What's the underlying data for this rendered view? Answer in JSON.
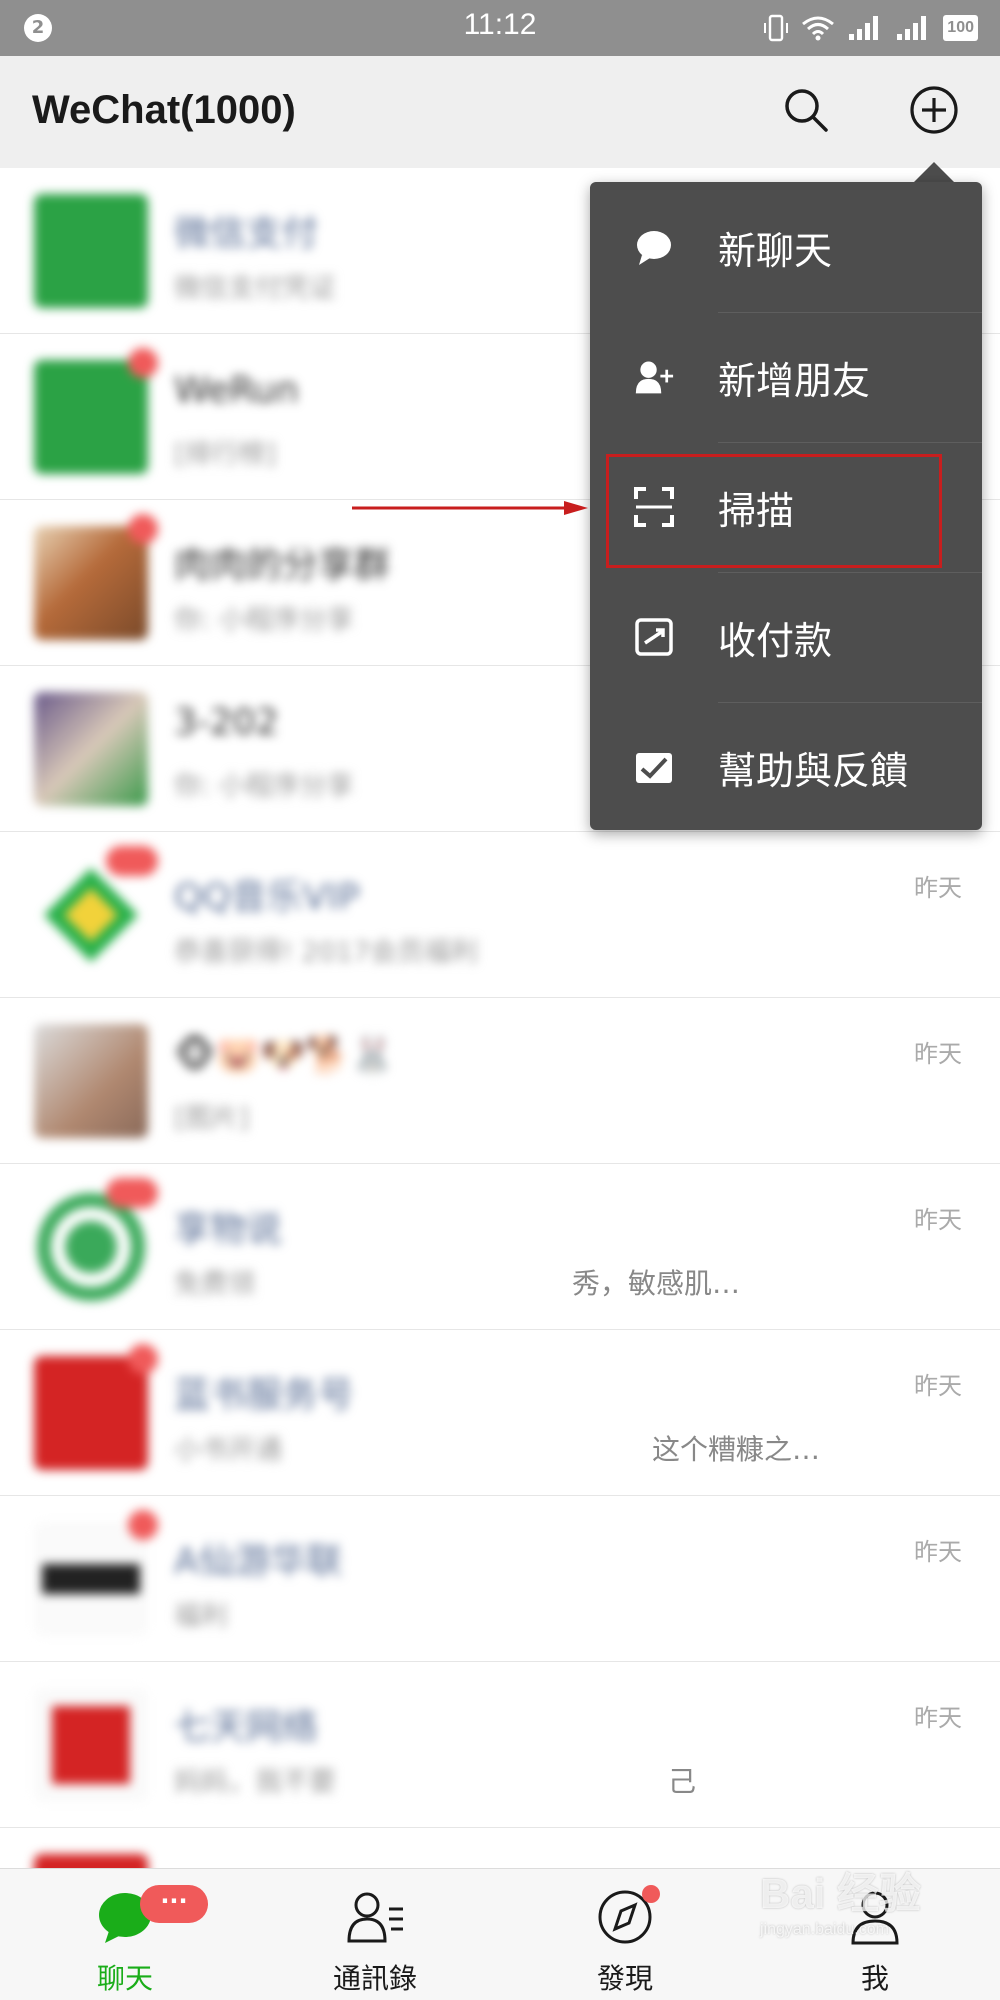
{
  "status_bar": {
    "notification_count": "2",
    "time": "11:12",
    "battery": "100",
    "icons": [
      "vibrate-icon",
      "wifi-icon",
      "signal-icon",
      "signal-icon"
    ]
  },
  "header": {
    "title": "WeChat(1000)",
    "search_icon": "search-icon",
    "add_icon": "plus-circle-icon"
  },
  "chats": [
    {
      "name": "微信支付",
      "preview": "微信支付凭证",
      "time": "",
      "badge": "",
      "avatar_color": "#2ba245"
    },
    {
      "name": "WeRun",
      "preview": "[排行榜]",
      "time": "",
      "badge": "",
      "avatar_color": "#2ba245"
    },
    {
      "name": "肉肉的分享群",
      "preview": "你: 小程序分享",
      "time": "",
      "badge": "",
      "avatar_color": "#b56a3a"
    },
    {
      "name": "3-202",
      "preview": "你: 小程序分享",
      "time": "",
      "badge": "",
      "avatar_color": "#6a5a8a"
    },
    {
      "name": "QQ音乐VIP",
      "preview": "恭喜获得! 2017会员福利",
      "time": "昨天",
      "badge": "",
      "avatar_color": "#27b04a"
    },
    {
      "name": "🐵🐷🐶🐕🐰",
      "preview": "[图片]",
      "time": "昨天",
      "badge": "",
      "avatar_color": "#b08870"
    },
    {
      "name": "享物说",
      "preview": "免费领 ",
      "preview_tail": "秀，敏感肌…",
      "time": "昨天",
      "badge": "",
      "avatar_color": "#3aa95a"
    },
    {
      "name": "蓝书服务号",
      "preview": "小书开通",
      "preview_tail": "这个糟糠之…",
      "time": "昨天",
      "badge": "",
      "avatar_color": "#d42424"
    },
    {
      "name": "A仙游华联",
      "preview": "福利",
      "time": "昨天",
      "badge": "",
      "avatar_color": "#222222"
    },
    {
      "name": "七天网络",
      "preview": "妈妈，我不要",
      "preview_tail": "己",
      "time": "昨天",
      "badge": "",
      "avatar_color": "#d42424"
    },
    {
      "name": "",
      "preview": "",
      "time": "",
      "badge": "",
      "avatar_color": "#d42424"
    }
  ],
  "menu": {
    "items": [
      {
        "label": "新聊天",
        "icon": "chat-bubble-icon"
      },
      {
        "label": "新增朋友",
        "icon": "add-friend-icon"
      },
      {
        "label": "掃描",
        "icon": "scan-icon"
      },
      {
        "label": "收付款",
        "icon": "payment-icon"
      },
      {
        "label": "幫助與反饋",
        "icon": "feedback-icon"
      }
    ],
    "highlight_color": "#c81e1e"
  },
  "bottom_nav": {
    "tabs": [
      {
        "label": "聊天",
        "icon": "chat-icon",
        "active": true,
        "badge": "···"
      },
      {
        "label": "通訊錄",
        "icon": "contacts-icon",
        "active": false,
        "badge": ""
      },
      {
        "label": "發現",
        "icon": "compass-icon",
        "active": false,
        "badge": "dot"
      },
      {
        "label": "我",
        "icon": "profile-icon",
        "active": false,
        "badge": ""
      }
    ],
    "active_color": "#1aad19"
  },
  "watermark": {
    "text": "Bai 经验",
    "sub": "jingyan.baidu.com"
  }
}
